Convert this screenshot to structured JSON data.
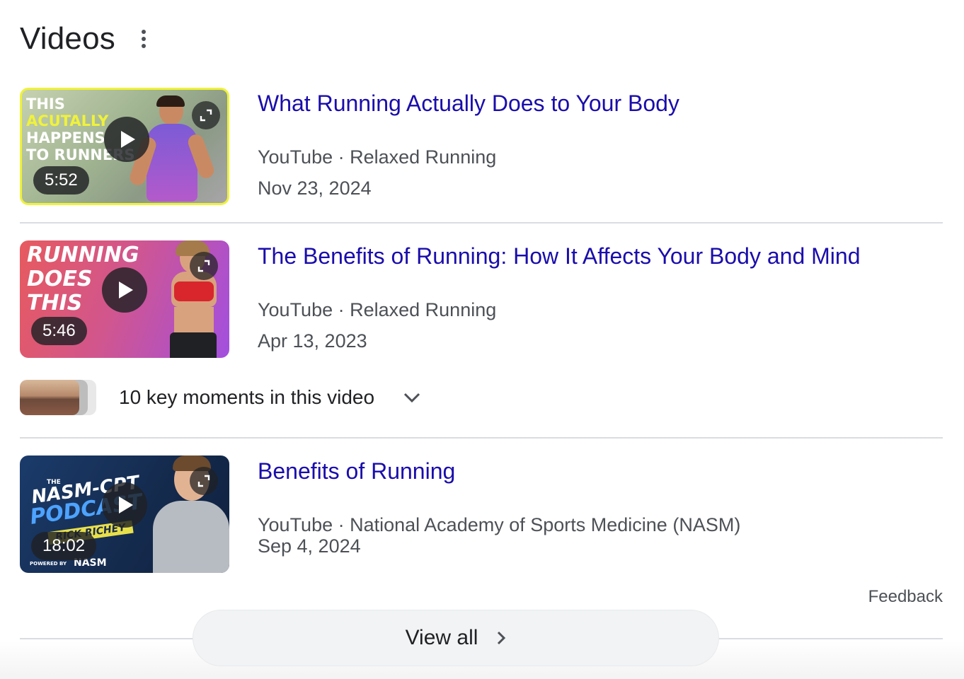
{
  "section": {
    "title": "Videos"
  },
  "videos": [
    {
      "title": "What Running Actually Does to Your Body",
      "source": "YouTube",
      "channel": "Relaxed Running",
      "meta": "YouTube · Relaxed Running",
      "date": "Nov 23, 2024",
      "duration": "5:52",
      "thumb_text": [
        "THIS",
        "ACUTALLY",
        "HAPPENS",
        "TO RUNNERS"
      ],
      "thumb_colors": {
        "bg": "#b9c7a8",
        "border": "#f0f23a",
        "text": "#ffffff"
      }
    },
    {
      "title": "The Benefits of Running: How It Affects Your Body and Mind",
      "source": "YouTube",
      "channel": "Relaxed Running",
      "meta": "YouTube · Relaxed Running",
      "date": "Apr 13, 2023",
      "duration": "5:46",
      "thumb_text": [
        "RUNNING",
        "DOES",
        "THIS"
      ],
      "thumb_colors": {
        "bg_from": "#e85c5c",
        "bg_to": "#9b4dde",
        "text": "#ffffff"
      }
    },
    {
      "title": "Benefits of Running",
      "source": "YouTube",
      "channel": "National Academy of Sports Medicine (NASM)",
      "meta": "YouTube · National Academy of Sports Medicine (NASM)",
      "date": "Sep 4, 2024",
      "duration": "18:02",
      "thumb_text": [
        "THE",
        "NASM-CPT",
        "PODCAST",
        "RICK RICHEY",
        "POWERED BY",
        "NASM"
      ],
      "thumb_colors": {
        "bg": "#16315a",
        "accent": "#e8e04a",
        "text": "#ffffff"
      }
    }
  ],
  "key_moments": {
    "label": "10 key moments in this video"
  },
  "feedback_label": "Feedback",
  "view_all": {
    "label": "View all"
  },
  "icons": {
    "more": "more-vert-icon",
    "play": "play-icon",
    "expand": "expand-icon",
    "chevron_down": "chevron-down-icon",
    "chevron_right": "chevron-right-icon"
  }
}
